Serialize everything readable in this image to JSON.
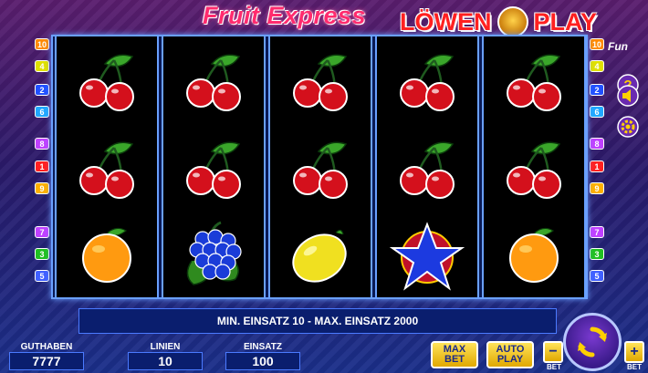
{
  "header": {
    "game_title": "Fruit Express",
    "logo_left": "LÖWEN",
    "logo_right": "PLAY",
    "logo_sub": "Fun"
  },
  "reels": [
    [
      "cherry",
      "cherry",
      "orange"
    ],
    [
      "cherry",
      "cherry",
      "grapes"
    ],
    [
      "cherry",
      "cherry",
      "lemon"
    ],
    [
      "cherry",
      "cherry",
      "star"
    ],
    [
      "cherry",
      "cherry",
      "orange"
    ]
  ],
  "paylines": {
    "left": [
      "10",
      "4",
      "2",
      "6",
      "8",
      "1",
      "9",
      "7",
      "3",
      "5"
    ],
    "right": [
      "10",
      "4",
      "2",
      "6",
      "8",
      "1",
      "9",
      "7",
      "3",
      "5"
    ]
  },
  "info": {
    "message": "MIN. EINSATZ 10 - MAX. EINSATZ 2000"
  },
  "stats": {
    "balance_label": "GUTHABEN",
    "balance_value": "7777",
    "lines_label": "LINIEN",
    "lines_value": "10",
    "bet_label": "EINSATZ",
    "bet_value": "100"
  },
  "buttons": {
    "max_bet_line1": "MAX",
    "max_bet_line2": "BET",
    "auto_play_line1": "AUTO",
    "auto_play_line2": "PLAY",
    "bet_minus": "−",
    "bet_plus": "+",
    "bet_minus_label": "BET",
    "bet_plus_label": "BET",
    "help": "?"
  },
  "colors": {
    "badge_colors": [
      "#ff8a00",
      "#e0e000",
      "#2050ff",
      "#20a8ff",
      "#c040ff",
      "#ff2020",
      "#ffb000",
      "#c040ff",
      "#20c020",
      "#4060ff"
    ]
  }
}
